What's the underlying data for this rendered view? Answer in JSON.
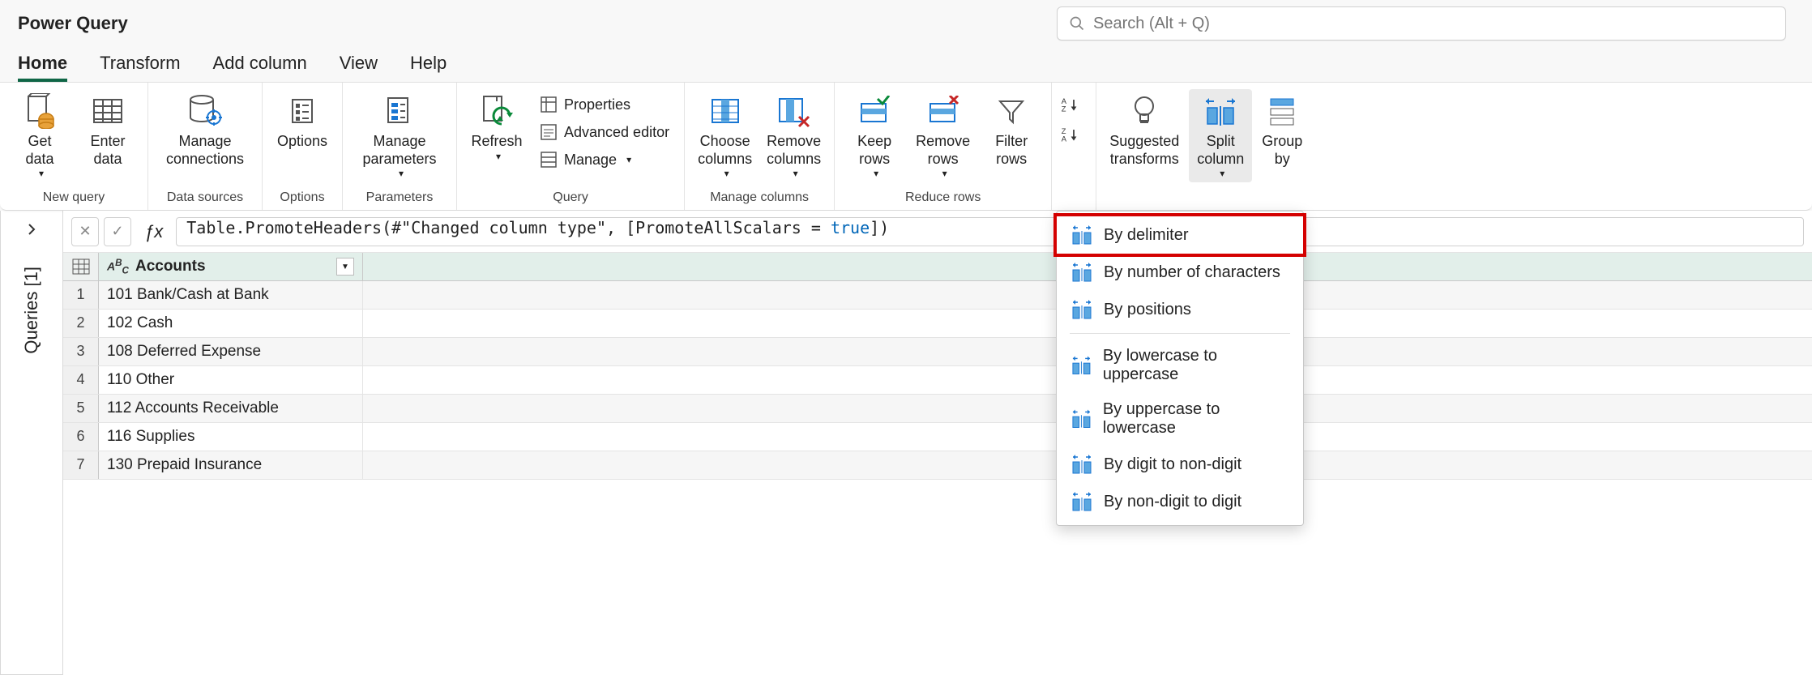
{
  "app": {
    "title": "Power Query"
  },
  "search": {
    "placeholder": "Search (Alt + Q)"
  },
  "tabs": {
    "home": "Home",
    "transform": "Transform",
    "add_column": "Add column",
    "view": "View",
    "help": "Help",
    "active": "home"
  },
  "ribbon": {
    "groups": {
      "new_query": {
        "label": "New query",
        "get_data": "Get\ndata",
        "enter_data": "Enter\ndata"
      },
      "data_sources": {
        "label": "Data sources",
        "manage_connections": "Manage\nconnections"
      },
      "options": {
        "label": "Options",
        "options": "Options"
      },
      "parameters": {
        "label": "Parameters",
        "manage_parameters": "Manage\nparameters"
      },
      "query": {
        "label": "Query",
        "refresh": "Refresh",
        "properties": "Properties",
        "advanced_editor": "Advanced editor",
        "manage": "Manage"
      },
      "manage_columns": {
        "label": "Manage columns",
        "choose_columns": "Choose\ncolumns",
        "remove_columns": "Remove\ncolumns"
      },
      "reduce_rows": {
        "label": "Reduce rows",
        "keep_rows": "Keep\nrows",
        "remove_rows": "Remove\nrows",
        "filter_rows": "Filter\nrows"
      },
      "sort": {
        "label": ""
      },
      "transform": {
        "suggested": "Suggested\ntransforms",
        "split_column": "Split\ncolumn",
        "group_by": "Group\nby"
      }
    }
  },
  "split_menu": {
    "by_delimiter": "By delimiter",
    "by_number_chars": "By number of characters",
    "by_positions": "By positions",
    "by_lower_upper": "By lowercase to uppercase",
    "by_upper_lower": "By uppercase to lowercase",
    "by_digit_nondigit": "By digit to non-digit",
    "by_nondigit_digit": "By non-digit to digit"
  },
  "sidebar": {
    "label": "Queries [1]"
  },
  "formula_bar": {
    "text": "Table.PromoteHeaders(#\"Changed column type\", [PromoteAllScalars = true])"
  },
  "grid": {
    "column_header": "Accounts",
    "rows": [
      "101 Bank/Cash at Bank",
      "102 Cash",
      "108 Deferred Expense",
      "110 Other",
      "112 Accounts Receivable",
      "116 Supplies",
      "130 Prepaid Insurance"
    ]
  }
}
